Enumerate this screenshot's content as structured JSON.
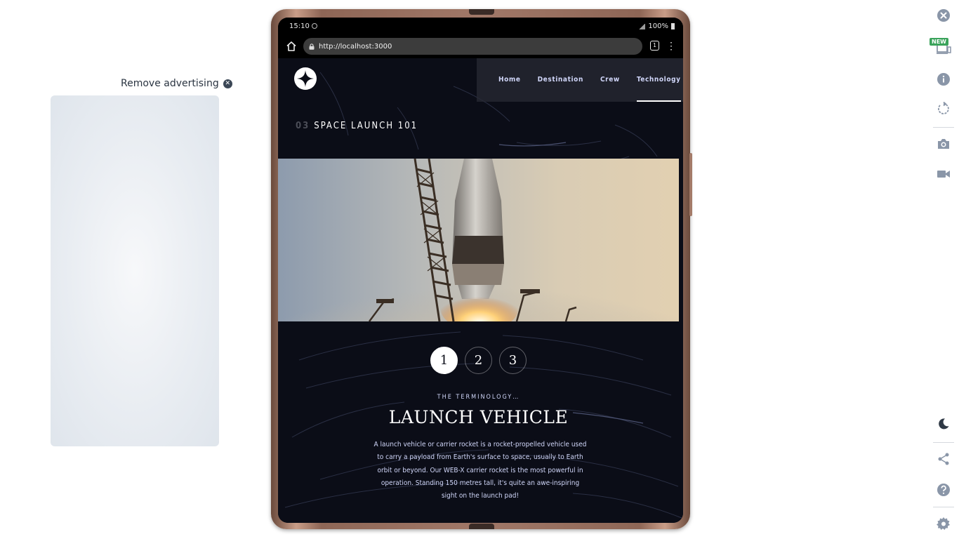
{
  "ad": {
    "remove_label": "Remove advertising"
  },
  "phone_status": {
    "time": "15:10",
    "battery": "100%"
  },
  "browser": {
    "url": "http://localhost:3000",
    "tab_count": "1",
    "menu_glyph": "⋮"
  },
  "site": {
    "nav": [
      {
        "label": "Home",
        "active": false
      },
      {
        "label": "Destination",
        "active": false
      },
      {
        "label": "Crew",
        "active": false
      },
      {
        "label": "Technology",
        "active": true
      }
    ],
    "heading_number": "03",
    "heading_text": "SPACE LAUNCH 101",
    "steps": [
      "1",
      "2",
      "3"
    ],
    "active_step": "1",
    "subtitle": "THE TERMINOLOGY…",
    "title": "LAUNCH VEHICLE",
    "description": "A launch vehicle or carrier rocket is a rocket-propelled vehicle used to carry a payload from Earth's surface to space, usually to Earth orbit or beyond. Our WEB-X carrier rocket is the most powerful in operation. Standing 150 metres tall, it's quite an awe-inspiring sight on the launch pad!"
  },
  "toolbar": {
    "new_badge": "NEW",
    "icons": [
      "close-icon",
      "devices-icon",
      "info-icon",
      "rotate-icon",
      "camera-icon",
      "video-icon",
      "dark-mode-icon",
      "share-icon",
      "help-icon",
      "settings-icon"
    ]
  },
  "colors": {
    "site_background": "#0b0d17",
    "nav_text": "#d0d6f9",
    "toolbar_icon": "#8a96a8",
    "new_badge": "#3aa35b"
  }
}
